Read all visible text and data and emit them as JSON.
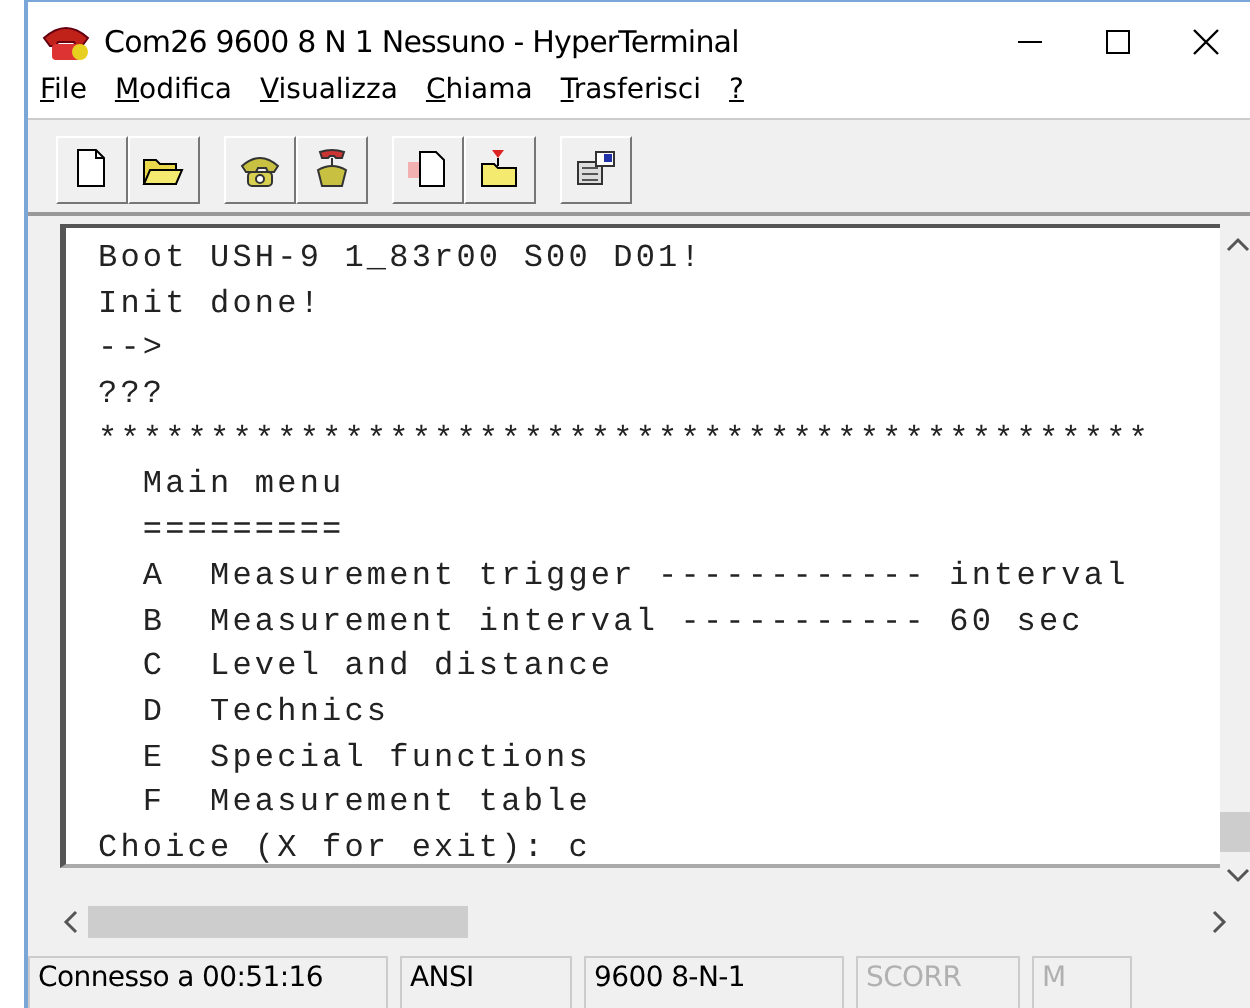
{
  "window": {
    "title": "Com26 9600 8 N 1 Nessuno - HyperTerminal"
  },
  "menu": [
    {
      "label": "File"
    },
    {
      "label": "Modifica"
    },
    {
      "label": "Visualizza"
    },
    {
      "label": "Chiama"
    },
    {
      "label": "Trasferisci"
    },
    {
      "label": "?"
    }
  ],
  "toolbar": [
    {
      "kind": "new"
    },
    {
      "kind": "open"
    },
    {
      "kind": "call"
    },
    {
      "kind": "hangup"
    },
    {
      "kind": "send"
    },
    {
      "kind": "receive"
    },
    {
      "kind": "properties"
    }
  ],
  "terminal": {
    "lines": [
      "Boot USH-9 1_83r00 S00 D01!",
      "Init done!",
      "-->",
      "???",
      "***********************************************",
      "  Main menu",
      "  =========",
      "  A  Measurement trigger ------------ interval",
      "  B  Measurement interval ----------- 60 sec",
      "  C  Level and distance",
      "  D  Technics",
      "  E  Special functions",
      "  F  Measurement table",
      "Choice (X for exit): c"
    ]
  },
  "status_bar": [
    {
      "text": "Connesso a 00:51:16",
      "disabled": false
    },
    {
      "text": "ANSI",
      "disabled": false
    },
    {
      "text": "9600 8-N-1",
      "disabled": false
    },
    {
      "text": "SCORR",
      "disabled": true
    },
    {
      "text": "M",
      "disabled": true
    }
  ]
}
